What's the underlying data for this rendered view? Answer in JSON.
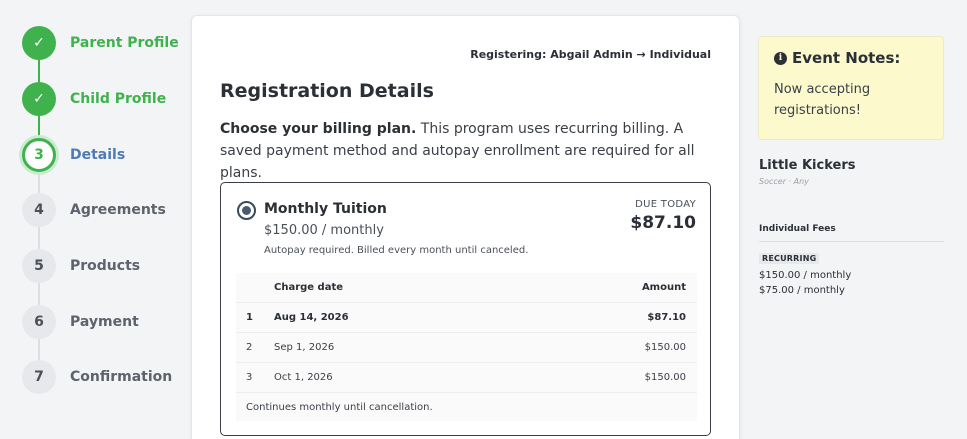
{
  "stepper": {
    "steps": [
      {
        "number": "1",
        "label": "Parent Profile",
        "state": "done"
      },
      {
        "number": "2",
        "label": "Child Profile",
        "state": "done"
      },
      {
        "number": "3",
        "label": "Details",
        "state": "current"
      },
      {
        "number": "4",
        "label": "Agreements",
        "state": "pending"
      },
      {
        "number": "5",
        "label": "Products",
        "state": "pending"
      },
      {
        "number": "6",
        "label": "Payment",
        "state": "pending"
      },
      {
        "number": "7",
        "label": "Confirmation",
        "state": "pending"
      }
    ],
    "done_glyph": "✓"
  },
  "main": {
    "registering": "Registering: Abgail Admin → Individual",
    "title": "Registration Details",
    "intro_bold": "Choose your billing plan.",
    "intro_rest": " This program uses recurring billing. A saved payment method and autopay enrollment are required for all plans.",
    "plan": {
      "name": "Monthly Tuition",
      "price": "$150.00 / monthly",
      "note": "Autopay required. Billed every month until canceled.",
      "due_label": "DUE TODAY",
      "due_amount": "$87.10",
      "schedule": {
        "headers": {
          "date": "Charge date",
          "amount": "Amount"
        },
        "rows": [
          {
            "num": "1",
            "date": "Aug 14, 2026",
            "amount": "$87.10"
          },
          {
            "num": "2",
            "date": "Sep 1, 2026",
            "amount": "$150.00"
          },
          {
            "num": "3",
            "date": "Oct 1, 2026",
            "amount": "$150.00"
          }
        ],
        "footer": "Continues monthly until cancellation."
      }
    }
  },
  "sidebar": {
    "notes_title": "Event Notes:",
    "notes_icon": "i",
    "notes_text": "Now accepting registrations!",
    "program_name": "Little Kickers",
    "program_sub": "Soccer · Any",
    "fees_title": "Individual Fees",
    "badge": "RECURRING",
    "fees": [
      "$150.00 / monthly",
      "$75.00 / monthly"
    ]
  },
  "colors": {
    "accent_green": "#3fb24e",
    "current_step_blue": "#4e7bb3",
    "notes_yellow": "#fcfacd"
  }
}
